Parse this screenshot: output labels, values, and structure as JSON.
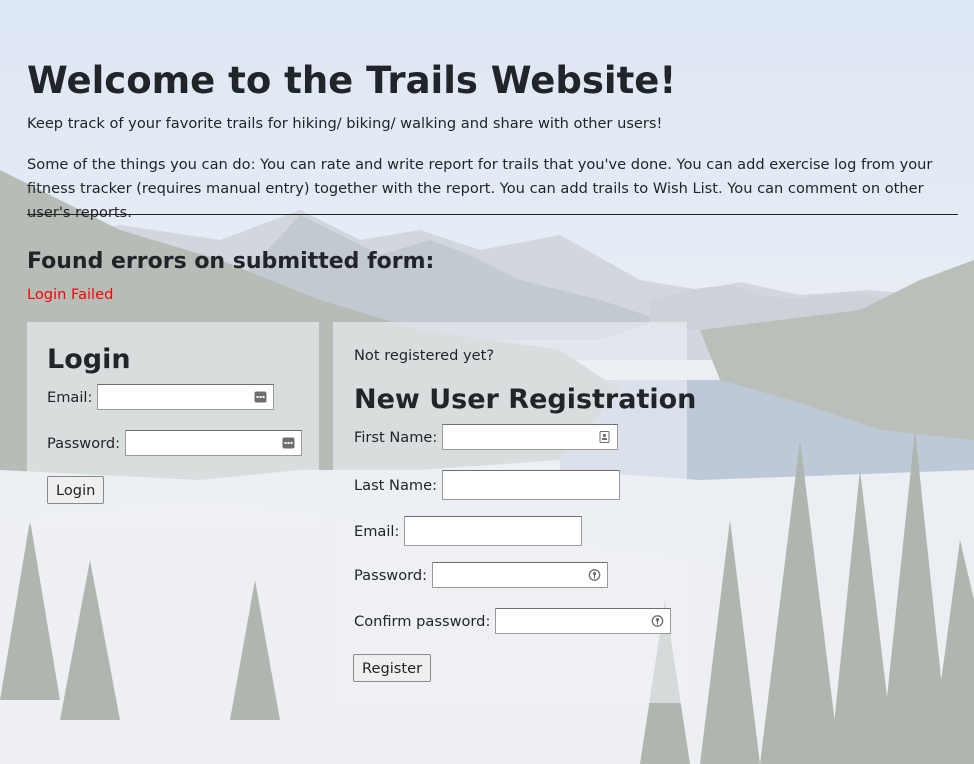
{
  "header": {
    "title": "Welcome to the Trails Website!",
    "intro": "Keep track of your favorite trails for hiking/ biking/ walking and share with other users!",
    "features": "Some of the things you can do: You can rate and write report for trails that you've done. You can add exercise log from your fitness tracker (requires manual entry) together with the report. You can add trails to Wish List. You can comment on other user's reports."
  },
  "errors": {
    "title": "Found errors on submitted form:",
    "message": "Login Failed",
    "message_color": "#ff0000"
  },
  "login": {
    "title": "Login",
    "email_label": "Email:",
    "email_value": "",
    "password_label": "Password:",
    "password_value": "",
    "button_label": "Login",
    "field_icon": "autofill-keyboard-icon"
  },
  "register": {
    "prompt": "Not registered yet?",
    "title": "New User Registration",
    "first_name_label": "First Name:",
    "first_name_value": "",
    "first_name_icon": "contact-card-icon",
    "last_name_label": "Last Name:",
    "last_name_value": "",
    "email_label": "Email:",
    "email_value": "",
    "password_label": "Password:",
    "password_value": "",
    "password_icon": "password-key-icon",
    "confirm_label": "Confirm password:",
    "confirm_value": "",
    "button_label": "Register"
  }
}
